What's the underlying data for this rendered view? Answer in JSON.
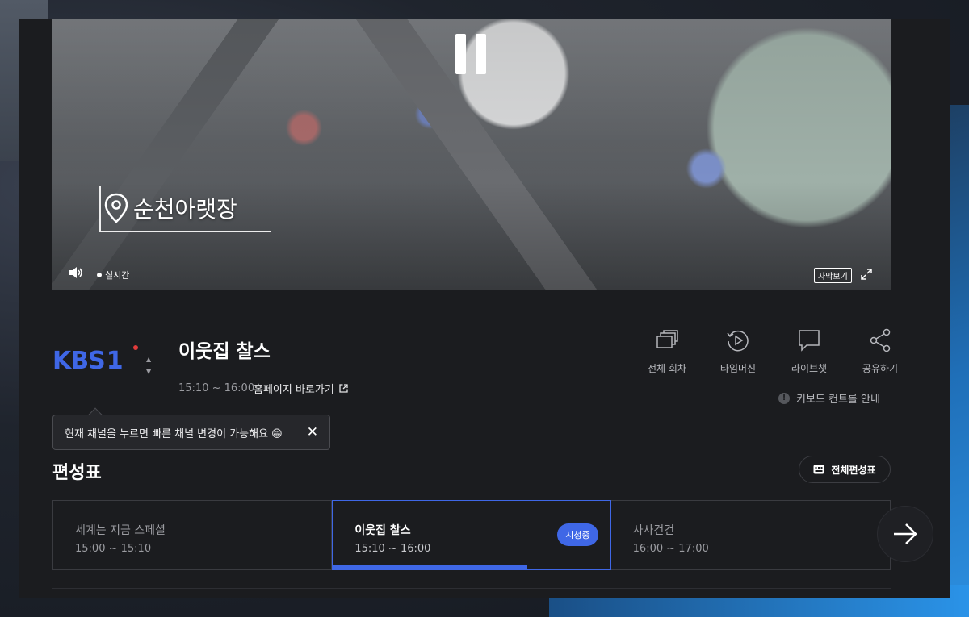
{
  "player": {
    "location_caption": "순천아랫장",
    "live_label": "실시간",
    "subtitle_label": "자막보기"
  },
  "channel": {
    "logo_text": "KBS",
    "logo_number": "1"
  },
  "program": {
    "title": "이웃집 찰스",
    "time": "15:10 ~ 16:00",
    "homepage_link": "홈페이지 바로가기"
  },
  "actions": [
    {
      "label": "전체 회차",
      "icon": "episodes-icon"
    },
    {
      "label": "타임머신",
      "icon": "timemachine-icon"
    },
    {
      "label": "라이브챗",
      "icon": "chat-icon"
    },
    {
      "label": "공유하기",
      "icon": "share-icon"
    }
  ],
  "keyboard_guide": "키보드 컨트롤 안내",
  "tooltip": {
    "message": "현재 채널을 누르면 빠른 채널 변경이 가능해요 😁"
  },
  "schedule": {
    "title": "편성표",
    "full_button": "전체편성표",
    "items": [
      {
        "title": "세계는 지금 스페셜",
        "time": "15:00 ~ 15:10",
        "active": false
      },
      {
        "title": "이웃집 찰스",
        "time": "15:10 ~ 16:00",
        "active": true,
        "badge": "시청중",
        "progress": 0.7
      },
      {
        "title": "사사건건",
        "time": "16:00 ~ 17:00",
        "active": false
      }
    ]
  },
  "colors": {
    "accent": "#3f67e6",
    "panel_bg": "#1b1c1f",
    "live_dot_red": "#e23b3b"
  }
}
